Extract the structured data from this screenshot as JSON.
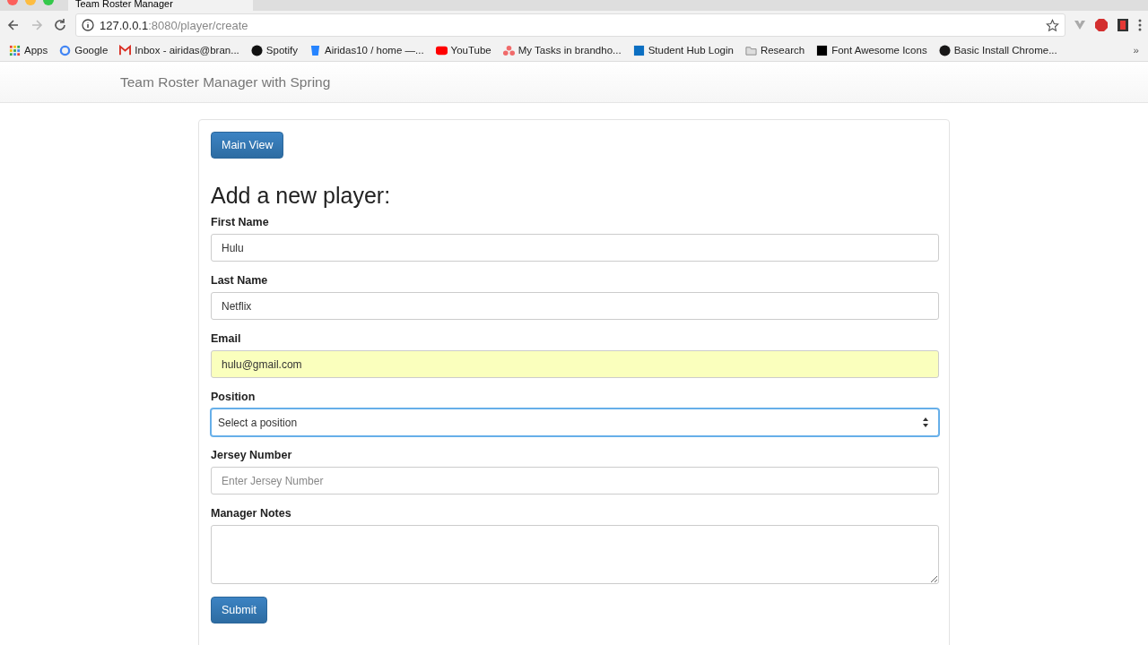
{
  "browser": {
    "tab_title": "Team Roster Manager",
    "url_host": "127.0.0.1",
    "url_path": ":8080/player/create",
    "bookmarks": [
      "Apps",
      "Google",
      "Inbox - airidas@bran...",
      "Spotify",
      "Airidas10 / home —...",
      "YouTube",
      "My Tasks in brandho...",
      "Student Hub Login",
      "Research",
      "Font Awesome Icons",
      "Basic Install Chrome..."
    ],
    "overflow": "»"
  },
  "navbar": {
    "brand": "Team Roster Manager with Spring"
  },
  "main_button": "Main View",
  "heading": "Add a new player:",
  "fields": [
    {
      "kind": "input",
      "label": "First Name",
      "value": "Hulu",
      "autofilled": false,
      "focused": false
    },
    {
      "kind": "input",
      "label": "Last Name",
      "value": "Netflix",
      "autofilled": false,
      "focused": false
    },
    {
      "kind": "input",
      "label": "Email",
      "value": "hulu@gmail.com",
      "autofilled": true,
      "focused": false
    },
    {
      "kind": "select",
      "label": "Position",
      "value": "Select a position",
      "autofilled": false,
      "focused": true
    },
    {
      "kind": "input",
      "label": "Jersey Number",
      "placeholder": "Enter Jersey Number",
      "autofilled": false,
      "focused": false
    },
    {
      "kind": "textarea",
      "label": "Manager Notes",
      "autofilled": false,
      "focused": false
    }
  ],
  "submit_button": "Submit"
}
